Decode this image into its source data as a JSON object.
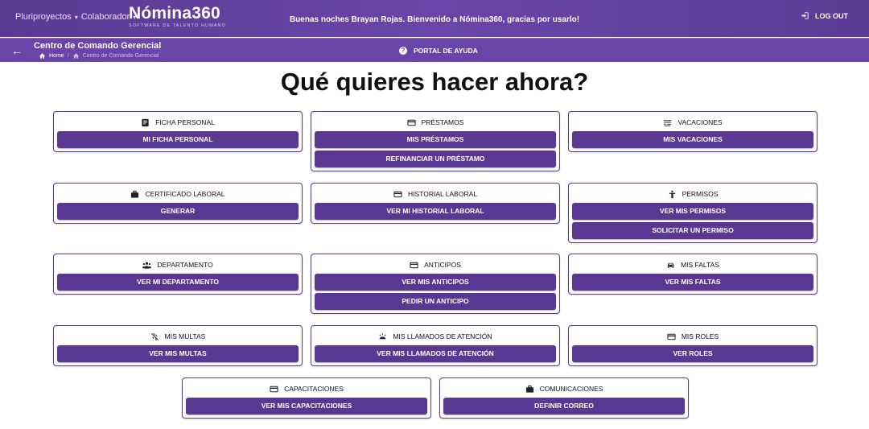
{
  "header": {
    "org": "Pluriproyectos",
    "role": "Colaborador",
    "logo": "Nómina360",
    "logo_subtitle": "SOFTWARE DE TALENTO HUMANO",
    "welcome": "Buenas noches Brayan Rojas. Bienvenido a Nómina360, gracias por usarlo!",
    "logout": "LOG OUT"
  },
  "subheader": {
    "title": "Centro de Comando Gerencial",
    "crumb_home": "Home",
    "crumb_current": "Centro de Comando Gerencial",
    "help": "PORTAL DE AYUDA"
  },
  "heading": "Qué quieres hacer ahora?",
  "cards": [
    {
      "title": "FICHA PERSONAL",
      "icon": "id-card-icon",
      "buttons": [
        "MI FICHA PERSONAL"
      ]
    },
    {
      "title": "PRÉSTAMOS",
      "icon": "credit-card-icon",
      "buttons": [
        "MIS PRÉSTAMOS",
        "REFINANCIAR UN PRÉSTAMO"
      ]
    },
    {
      "title": "VACACIONES",
      "icon": "beach-icon",
      "buttons": [
        "MIS VACACIONES"
      ]
    },
    {
      "title": "CERTIFICADO LABORAL",
      "icon": "briefcase-icon",
      "buttons": [
        "GENERAR"
      ]
    },
    {
      "title": "HISTORIAL LABORAL",
      "icon": "credit-card-icon",
      "buttons": [
        "VER MI HISTORIAL LABORAL"
      ]
    },
    {
      "title": "PERMISOS",
      "icon": "person-icon",
      "buttons": [
        "VER MIS PERMISOS",
        "SOLICITAR UN PERMISO"
      ]
    },
    {
      "title": "DEPARTAMENTO",
      "icon": "group-icon",
      "buttons": [
        "VER MI DEPARTAMENTO"
      ]
    },
    {
      "title": "ANTICIPOS",
      "icon": "credit-card-icon",
      "buttons": [
        "VER MIS ANTICIPOS",
        "PEDIR UN ANTICIPO"
      ]
    },
    {
      "title": "MIS FALTAS",
      "icon": "car-icon",
      "buttons": [
        "VER MIS FALTAS"
      ]
    },
    {
      "title": "MIS MULTAS",
      "icon": "crossed-icon",
      "buttons": [
        "VER MIS MULTAS"
      ]
    },
    {
      "title": "MIS LLAMADOS DE ATENCIÓN",
      "icon": "alarm-icon",
      "buttons": [
        "VER MIS LLAMADOS DE ATENCIÓN"
      ]
    },
    {
      "title": "MIS ROLES",
      "icon": "credit-card-icon",
      "buttons": [
        "VER ROLES"
      ]
    },
    {
      "title": "CAPACITACIONES",
      "icon": "credit-card-icon",
      "buttons": [
        "VER MIS CAPACITACIONES"
      ]
    },
    {
      "title": "COMUNICACIONES",
      "icon": "briefcase-icon",
      "buttons": [
        "DEFINIR CORREO"
      ]
    }
  ],
  "colors": {
    "header": "#5b3a93",
    "accent": "#5a3792",
    "border": "#5a3b91"
  }
}
